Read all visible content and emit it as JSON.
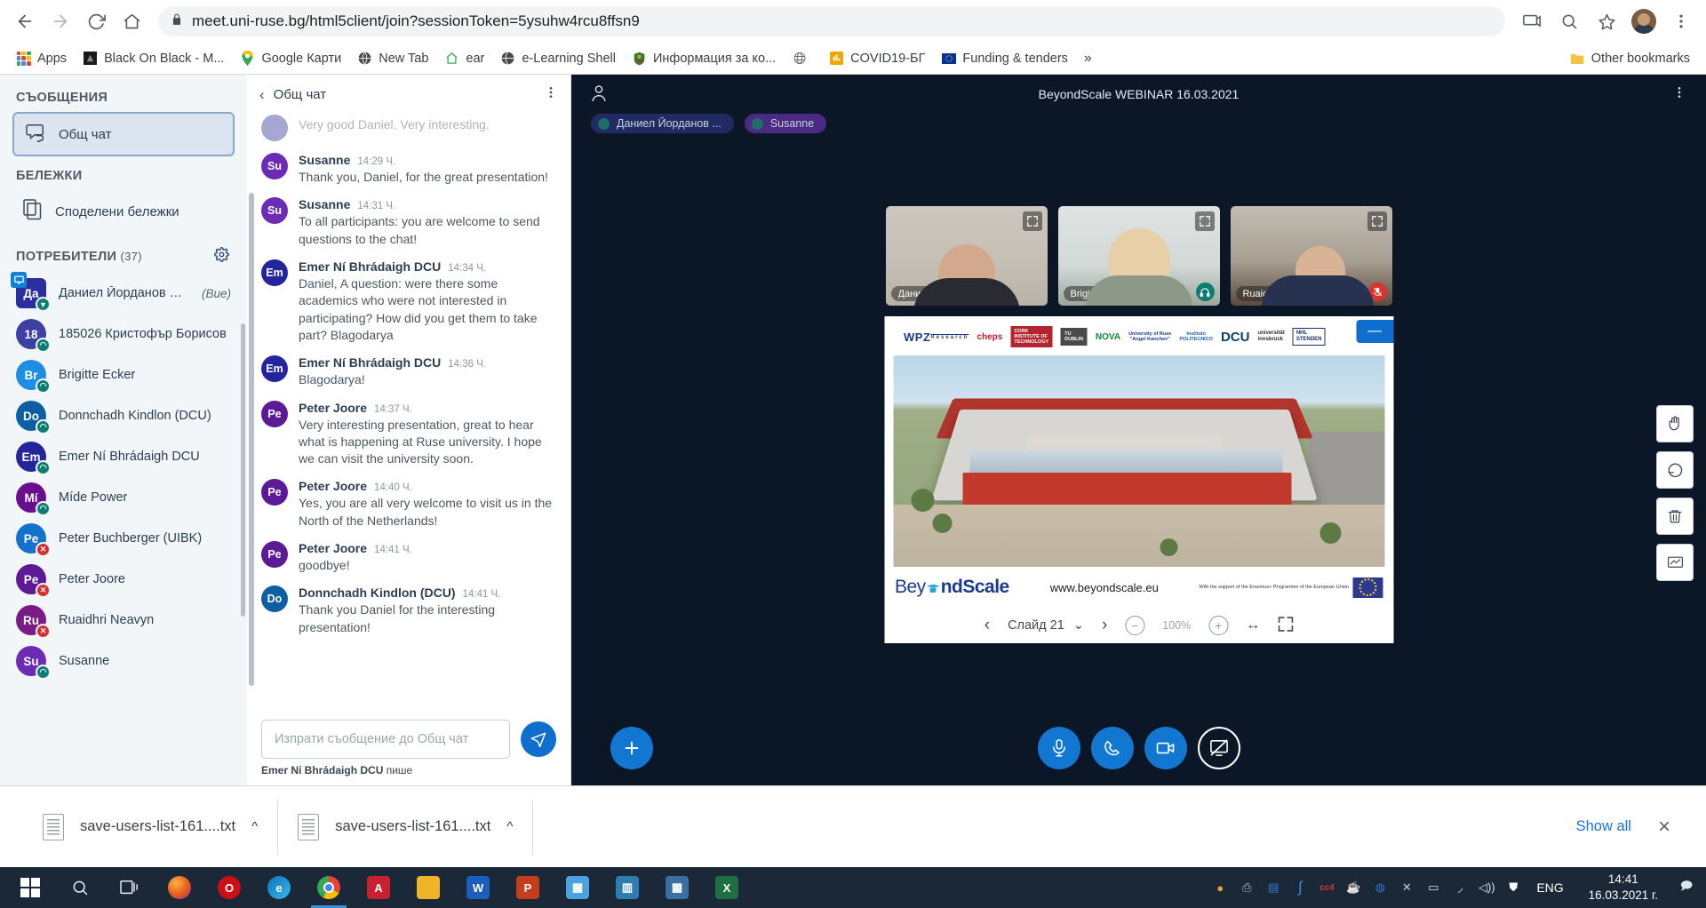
{
  "browser": {
    "url": "meet.uni-ruse.bg/html5client/join?sessionToken=5ysuhw4rcu8ffsn9",
    "back_label": "Back",
    "forward_label": "Forward",
    "reload_label": "Reload",
    "home_label": "Home",
    "cast_label": "Cast",
    "zoom_label": "Zoom",
    "bookmark_label": "Bookmark this tab",
    "profile_label": "Profile",
    "menu_label": "Customize and control Google Chrome",
    "bookmarks": [
      {
        "label": "Apps",
        "icon": "apps-grid-icon"
      },
      {
        "label": "Black On Black - M...",
        "icon": "site-icon"
      },
      {
        "label": "Google Карти",
        "icon": "maps-pin-icon"
      },
      {
        "label": "New Tab",
        "icon": "globe-icon"
      },
      {
        "label": "ear",
        "icon": "home-icon"
      },
      {
        "label": "e-Learning Shell",
        "icon": "globe-icon"
      },
      {
        "label": "Информация за ко...",
        "icon": "coat-of-arms-icon"
      },
      {
        "label": "",
        "icon": "globe-gray-icon"
      },
      {
        "label": "COVID19-БГ",
        "icon": "chart-icon"
      },
      {
        "label": "Funding & tenders",
        "icon": "eu-flag-icon"
      }
    ],
    "overflow_label": "»",
    "other_bookmarks": "Other bookmarks"
  },
  "sidebar": {
    "messages_heading": "СЪОБЩЕНИЯ",
    "public_chat": "Общ чат",
    "notes_heading": "БЕЛЕЖКИ",
    "shared_notes": "Споделени бележки",
    "users_heading": "ПОТРЕБИТЕЛИ",
    "users_count": "(37)",
    "settings_label": "Настройки",
    "users": [
      {
        "initials": "Да",
        "name": "Даниел Йорданов Пав…",
        "you": "(Вие)",
        "color": "#2b2f9e",
        "square": true,
        "presenter": true,
        "badge": "down"
      },
      {
        "initials": "18",
        "name": "185026 Кристофър Борисов",
        "color": "#3d3fa3",
        "badge": "headset"
      },
      {
        "initials": "Br",
        "name": "Brigitte Ecker",
        "color": "#1e8fe0",
        "badge": "headset"
      },
      {
        "initials": "Do",
        "name": "Donnchadh Kindlon (DCU)",
        "color": "#0d5fa4",
        "badge": "headset"
      },
      {
        "initials": "Em",
        "name": "Emer Ní Bhrádaigh DCU",
        "color": "#24259c",
        "badge": "headset"
      },
      {
        "initials": "Mí",
        "name": "Míde Power",
        "color": "#6a0d8f",
        "badge": "headset"
      },
      {
        "initials": "Pe",
        "name": "Peter Buchberger (UIBK)",
        "color": "#1372cc",
        "badge": "muted"
      },
      {
        "initials": "Pe",
        "name": "Peter Joore",
        "color": "#5c1a96",
        "badge": "muted"
      },
      {
        "initials": "Ru",
        "name": "Ruaidhri Neavyn",
        "color": "#7a1b86",
        "badge": "muted"
      },
      {
        "initials": "Su",
        "name": "Susanne",
        "color": "#6c2bb5",
        "badge": "headset"
      }
    ]
  },
  "chat": {
    "title": "Общ чат",
    "back_label": "Назад",
    "options_label": "Опции",
    "messages": [
      {
        "initials": "",
        "name": "",
        "time": "",
        "text": "Very good Daniel. Very interesting.",
        "color": "#3c3f9e",
        "faded": true
      },
      {
        "initials": "Su",
        "name": "Susanne",
        "time": "14:29 Ч.",
        "text": "Thank you, Daniel, for the great presentation!",
        "color": "#6c2bb5"
      },
      {
        "initials": "Su",
        "name": "Susanne",
        "time": "14:31 Ч.",
        "text": "To all participants: you are welcome to send questions to the chat!",
        "color": "#6c2bb5"
      },
      {
        "initials": "Em",
        "name": "Emer Ní Bhrádaigh DCU",
        "time": "14:34 Ч.",
        "text": "Daniel, A question: were there some academics who were not interested in participating? How did you get them to take part? Blagodarya",
        "color": "#24259c"
      },
      {
        "initials": "Em",
        "name": "Emer Ní Bhrádaigh DCU",
        "time": "14:36 Ч.",
        "text": "Blagodarya!",
        "color": "#24259c"
      },
      {
        "initials": "Pe",
        "name": "Peter Joore",
        "time": "14:37 Ч.",
        "text": "Very interesting presentation, great to hear what is happening at Ruse university. I hope we can visit the university soon.",
        "color": "#5c1a96"
      },
      {
        "initials": "Pe",
        "name": "Peter Joore",
        "time": "14:40 Ч.",
        "text": "Yes, you are all very welcome to visit us in the North of the Netherlands!",
        "color": "#5c1a96"
      },
      {
        "initials": "Pe",
        "name": "Peter Joore",
        "time": "14:41 Ч.",
        "text": "goodbye!",
        "color": "#5c1a96"
      },
      {
        "initials": "Do",
        "name": "Donnchadh Kindlon (DCU)",
        "time": "14:41 Ч.",
        "text": "Thank you Daniel for the interesting presentation!",
        "color": "#0d5fa4"
      }
    ],
    "input_placeholder": "Изпрати съобщение до Общ чат",
    "input_value": "",
    "send_label": "Изпрати",
    "typing_name": "Emer Ní Bhrádaigh DCU",
    "typing_suffix": "пише"
  },
  "meeting": {
    "title": "BeyondScale WEBINAR 16.03.2021",
    "user_icon_label": "Потребители",
    "options_label": "Опции",
    "chips": [
      {
        "label": "Даниел Йорданов ...",
        "color": "#222a63"
      },
      {
        "label": "Susanne",
        "color": "#4b2a84"
      }
    ],
    "cams": [
      {
        "name": "Даниел Йорданов П...",
        "status": "none"
      },
      {
        "name": "Brigitte Ecker",
        "status": "headset"
      },
      {
        "name": "Ruaidhri Neavyn",
        "status": "muted"
      }
    ],
    "actions": [
      {
        "name": "plus",
        "label": "Действия"
      },
      {
        "name": "microphone",
        "label": "Заглуши"
      },
      {
        "name": "phone",
        "label": "Напусни аудио"
      },
      {
        "name": "camera",
        "label": "Изключи камерата"
      },
      {
        "name": "screenshare-off",
        "label": "Спри споделяне на екрана"
      }
    ],
    "tools": [
      {
        "name": "pan-hand",
        "label": "Ръка"
      },
      {
        "name": "undo",
        "label": "Отмени"
      },
      {
        "name": "trash",
        "label": "Изтрий"
      },
      {
        "name": "presentation",
        "label": "Презентация"
      }
    ]
  },
  "presentation": {
    "minimize_label": "—",
    "logos": [
      "WPZ Research GmbH",
      "cheps",
      "Cork Institute of Technology",
      "TU Dublin",
      "NOVA de Lisboa",
      "University of Ruse Angel Kanchev",
      "Instituto Politecnico de Viana do Castelo",
      "DCU",
      "universität innsbruck",
      "NHL Stenden"
    ],
    "brand": "BeyondScale",
    "brand_left": "Bey",
    "brand_right": "ndScale",
    "url": "www.beyondscale.eu",
    "eu_text": "With the support of the Erasmus+ Programme of the European Union",
    "slide_label": "Слайд 21",
    "zoom_level": "100%",
    "prev_label": "Предишен слайд",
    "next_label": "Следващ слайд",
    "zoom_out_label": "Намали",
    "zoom_in_label": "Увеличи",
    "fit_width_label": "Побери по ширина",
    "fullscreen_label": "Цял екран"
  },
  "downloads": {
    "items": [
      {
        "name": "save-users-list-161....txt"
      },
      {
        "name": "save-users-list-161....txt"
      }
    ],
    "show_all": "Show all",
    "close_label": "×"
  },
  "taskbar": {
    "start_label": "Старт",
    "search_label": "Търсене",
    "taskview_label": "Изглед на задачите",
    "items": [
      {
        "name": "firefox",
        "glyph": "🦊",
        "color": "#e55b1f"
      },
      {
        "name": "opera",
        "glyph": "O",
        "color": "#cc0f16"
      },
      {
        "name": "edge",
        "glyph": "e",
        "color": "#0a74c4"
      },
      {
        "name": "chrome",
        "glyph": "◉",
        "color": "#d9534f",
        "active": true
      },
      {
        "name": "acrobat",
        "glyph": "A",
        "color": "#c8202e"
      },
      {
        "name": "explorer",
        "glyph": "▤",
        "color": "#f0b429"
      },
      {
        "name": "word",
        "glyph": "W",
        "color": "#1b5ebe"
      },
      {
        "name": "powerpoint",
        "glyph": "P",
        "color": "#c43e1c"
      },
      {
        "name": "photos",
        "glyph": "▦",
        "color": "#4aa3df"
      },
      {
        "name": "store",
        "glyph": "▥",
        "color": "#2e7db2"
      },
      {
        "name": "reader",
        "glyph": "▩",
        "color": "#3b6ea5"
      },
      {
        "name": "excel",
        "glyph": "X",
        "color": "#1d6f42"
      }
    ],
    "tray": [
      {
        "name": "bitdefender",
        "glyph": "●",
        "color": "#f0a030"
      },
      {
        "name": "printer",
        "glyph": "⎙",
        "color": "#9aa4ad"
      },
      {
        "name": "database",
        "glyph": "▤",
        "color": "#1b65c4"
      },
      {
        "name": "integral",
        "glyph": "∫",
        "color": "#2e7bd6"
      },
      {
        "name": "cc4",
        "glyph": "cc",
        "color": "#d73a2e"
      },
      {
        "name": "java",
        "glyph": "☕",
        "color": "#e76f2b"
      },
      {
        "name": "shield-blue",
        "glyph": "◍",
        "color": "#2a76c9"
      },
      {
        "name": "sync",
        "glyph": "✕",
        "color": "#c9ccd1"
      },
      {
        "name": "battery",
        "glyph": "▭",
        "color": "#dfe6ee"
      },
      {
        "name": "wifi",
        "glyph": "◞",
        "color": "#dfe6ee"
      },
      {
        "name": "volume",
        "glyph": "🔊",
        "color": "#dfe6ee"
      },
      {
        "name": "defender",
        "glyph": "⛊",
        "color": "#ffffff"
      }
    ],
    "language": "ENG",
    "time": "14:41",
    "date": "16.03.2021 г.",
    "notifications_label": "Известия"
  }
}
